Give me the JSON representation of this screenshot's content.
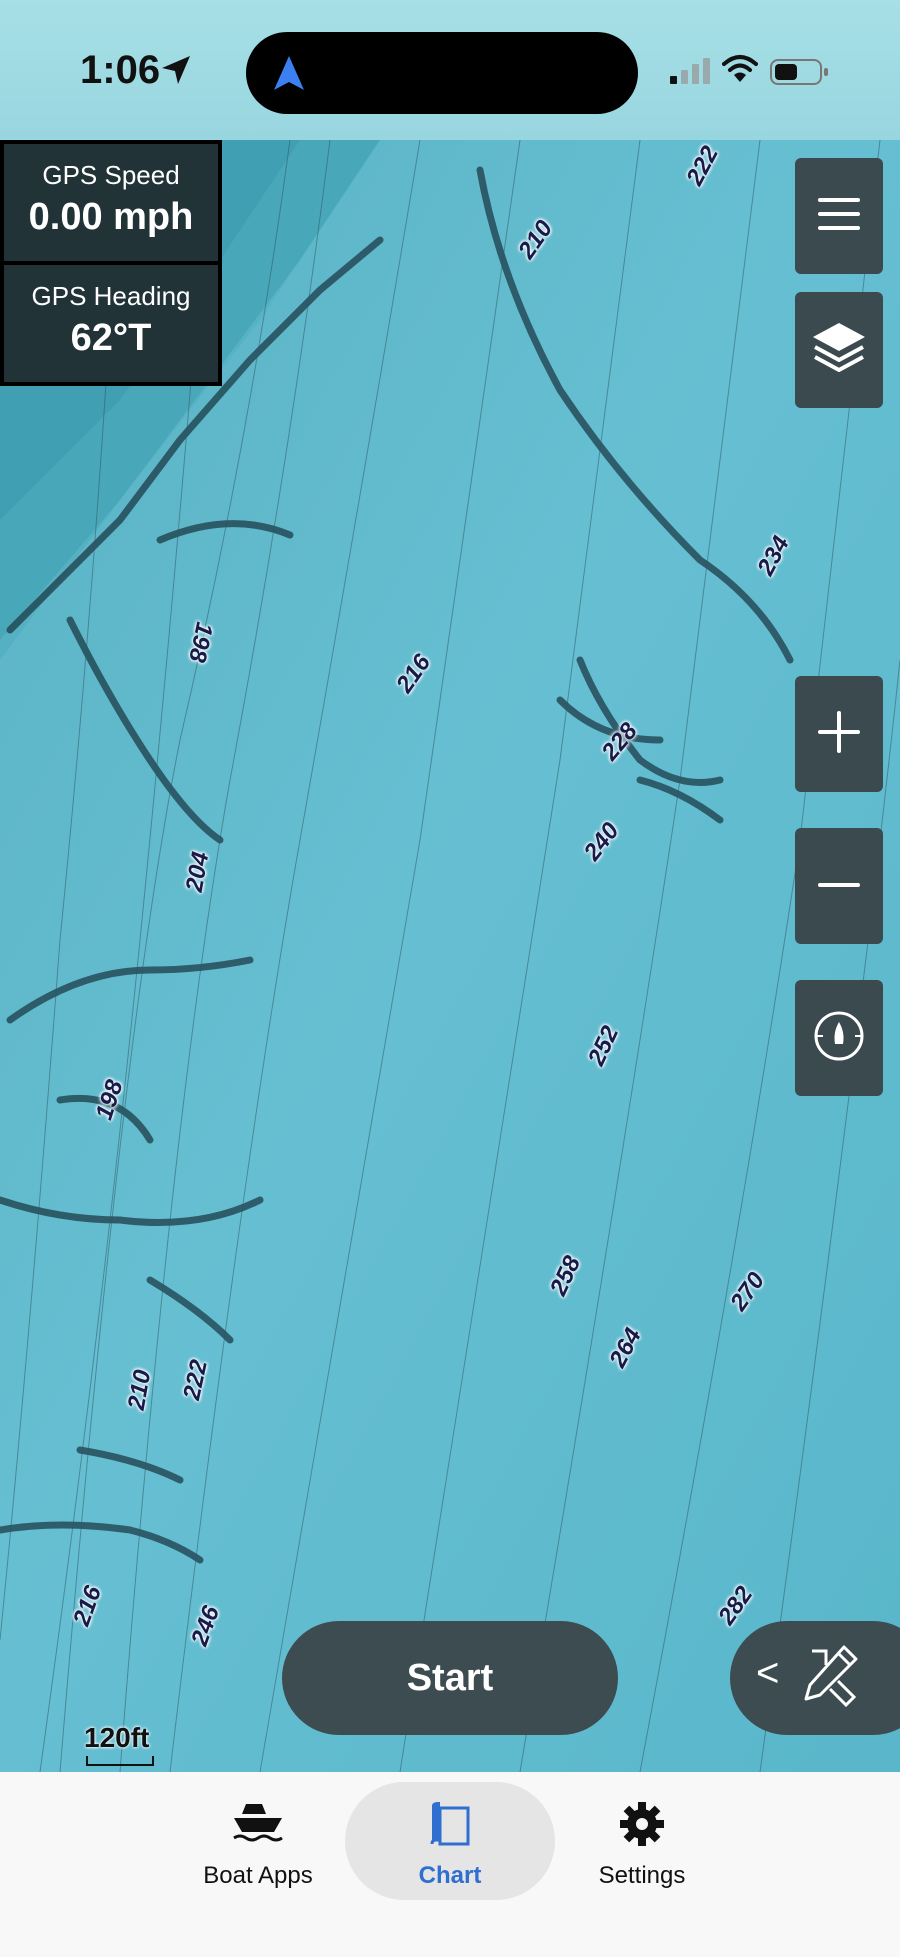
{
  "status_bar": {
    "time": "1:06",
    "icons": [
      "location-arrow-icon",
      "navigation-icon",
      "cellular-signal-icon",
      "wifi-icon",
      "battery-icon"
    ]
  },
  "gps": {
    "speed_label": "GPS Speed",
    "speed_value": "0.00 mph",
    "heading_label": "GPS Heading",
    "heading_value": "62°T"
  },
  "map": {
    "depth_labels": [
      "222",
      "210",
      "234",
      "198",
      "216",
      "228",
      "240",
      "204",
      "252",
      "198",
      "258",
      "270",
      "264",
      "210",
      "222",
      "216",
      "246",
      "282"
    ],
    "scale_label": "120ft"
  },
  "map_controls": [
    "menu-icon",
    "layers-icon",
    "zoom-in-icon",
    "zoom-out-icon",
    "compass-icon"
  ],
  "actions": {
    "start_label": "Start",
    "draw_chevron": "<"
  },
  "tabs": [
    {
      "label": "Boat Apps",
      "icon": "boat-icon",
      "active": false
    },
    {
      "label": "Chart",
      "icon": "chart-icon",
      "active": true
    },
    {
      "label": "Settings",
      "icon": "gear-icon",
      "active": false
    }
  ],
  "colors": {
    "accent": "#2e6fcf",
    "map_water": "#5fb9cc",
    "control_bg": "#3a4a4e"
  }
}
